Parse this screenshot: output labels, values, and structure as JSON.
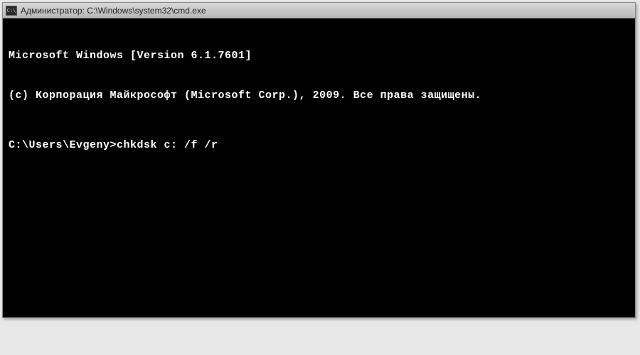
{
  "titlebar": {
    "icon_label": "C:\\",
    "title": "Администратор: C:\\Windows\\system32\\cmd.exe"
  },
  "console": {
    "line1": "Microsoft Windows [Version 6.1.7601]",
    "line2": "(c) Корпорация Майкрософт (Microsoft Corp.), 2009. Все права защищены.",
    "prompt": "C:\\Users\\Evgeny>",
    "command": "chkdsk c: /f /r"
  }
}
